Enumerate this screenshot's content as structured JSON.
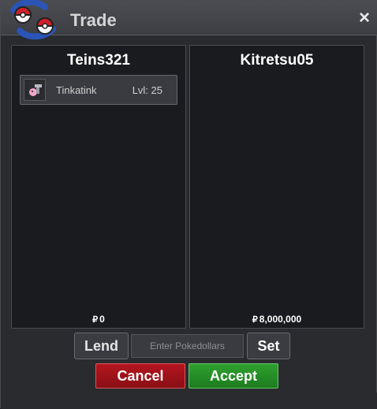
{
  "window": {
    "title": "Trade",
    "close_symbol": "×"
  },
  "trade": {
    "left": {
      "player": "Teins321",
      "items": [
        {
          "name": "Tinkatink",
          "level": "Lvl: 25"
        }
      ],
      "money_symbol": "₽",
      "money": "0"
    },
    "right": {
      "player": "Kitretsu05",
      "money_symbol": "₽",
      "money": "8,000,000"
    }
  },
  "controls": {
    "lend_label": "Lend",
    "pokedollar_placeholder": "Enter Pokedollars",
    "set_label": "Set",
    "cancel_label": "Cancel",
    "accept_label": "Accept"
  },
  "colors": {
    "cancel": "#b4161f",
    "accept": "#2fa02f",
    "panel_bg": "#1a1b1e"
  },
  "icons": {
    "logo": "pokeball-logo-icon",
    "close": "close-icon",
    "item": "tinkatink-sprite-icon",
    "currency": "pokedollar-icon"
  }
}
